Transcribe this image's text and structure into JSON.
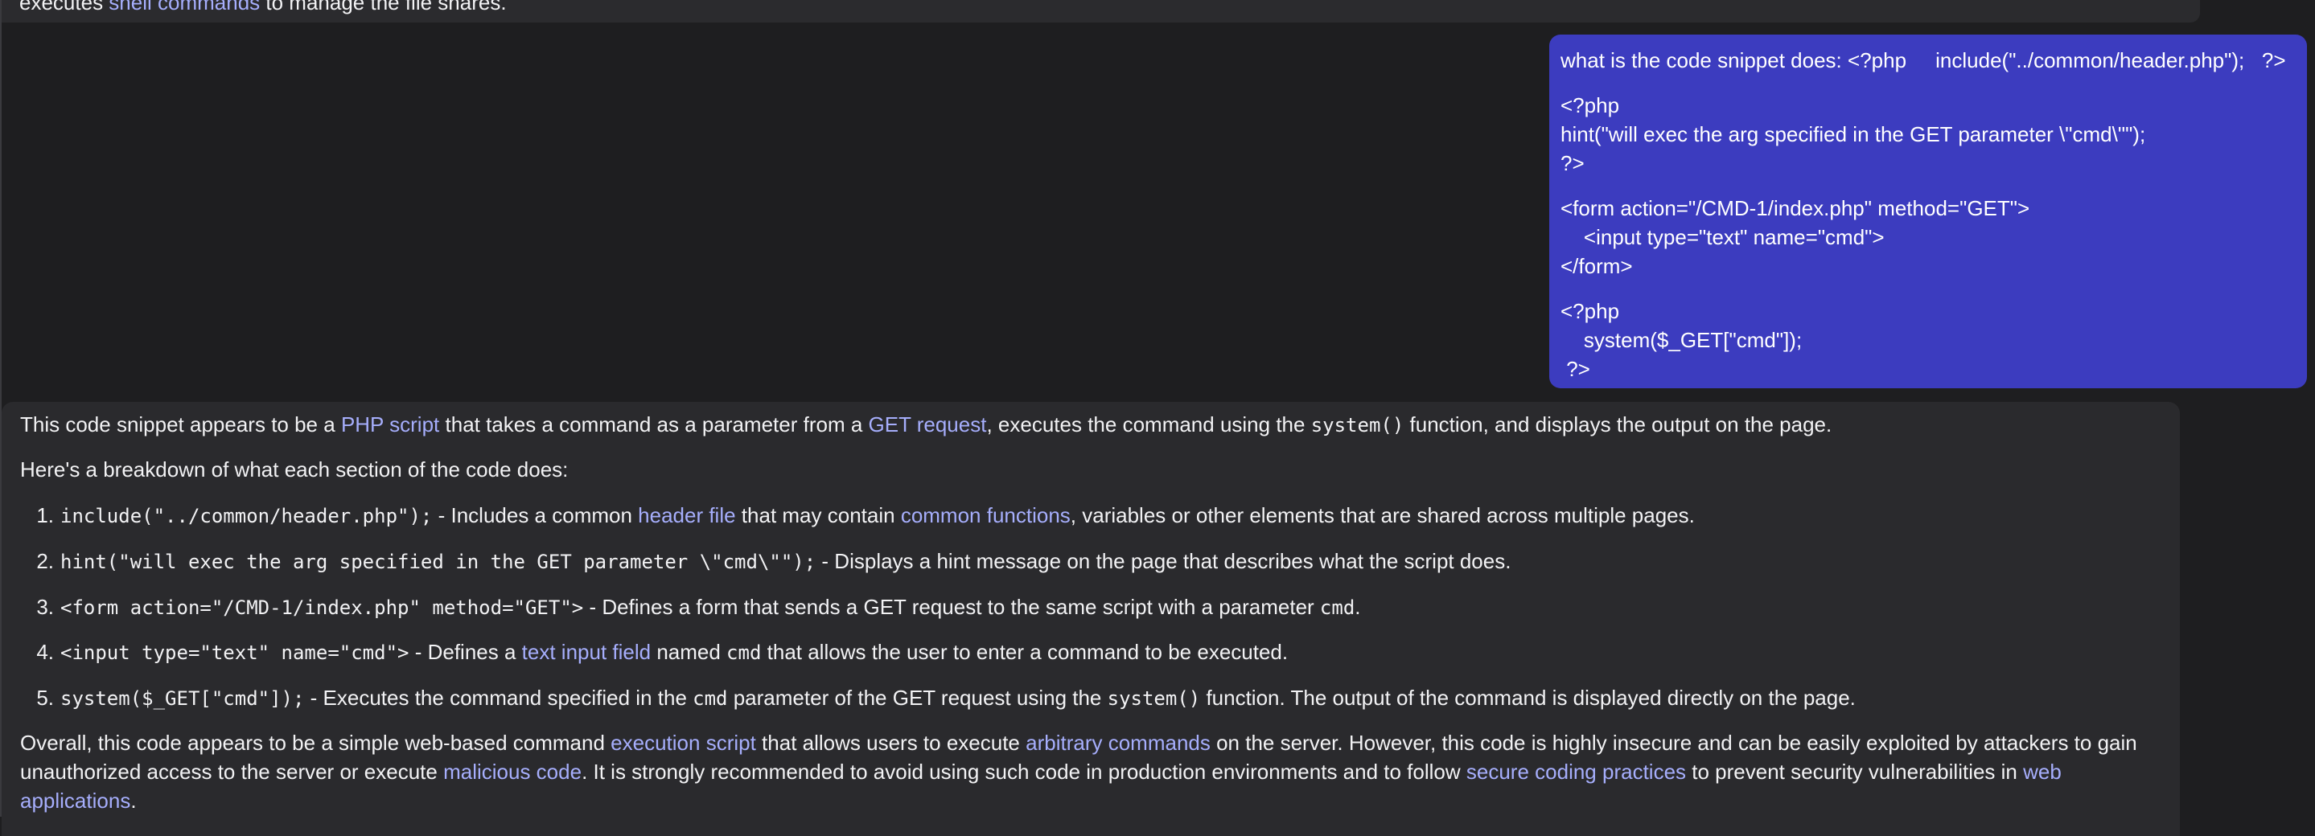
{
  "previous_message": {
    "pre": "executes ",
    "link": "shell commands",
    "post": " to manage the file shares."
  },
  "user_message": {
    "line1": "what is the code snippet does: <?php     include(\"../common/header.php\");   ?>",
    "block2": [
      "<?php",
      "hint(\"will exec the arg specified in the GET parameter \\\"cmd\\\"\");",
      "?>"
    ],
    "block3": [
      "<form action=\"/CMD-1/index.php\" method=\"GET\">",
      "    <input type=\"text\" name=\"cmd\">",
      "</form>"
    ],
    "block4": [
      "<?php",
      "    system($_GET[\"cmd\"]);",
      " ?>"
    ]
  },
  "assistant_message": {
    "intro": {
      "t1": "This code snippet appears to be a ",
      "l1": "PHP script",
      "t2": " that takes a command as a parameter from a ",
      "l2": "GET request",
      "t3": ", executes the command using the ",
      "c1": "system()",
      "t4": " function, and displays the output on the page."
    },
    "breakdown": "Here's a breakdown of what each section of the code does:",
    "items": [
      {
        "num": "1.",
        "code": "include(\"../common/header.php\");",
        "t1": " - Includes a common ",
        "l1": "header file",
        "t2": " that may contain ",
        "l2": "common functions",
        "t3": ", variables or other elements that are shared across multiple pages."
      },
      {
        "num": "2.",
        "code": "hint(\"will exec the arg specified in the GET parameter \\\"cmd\\\"\");",
        "t1": " - Displays a hint message on the page that describes what the script does."
      },
      {
        "num": "3.",
        "code": "<form action=\"/CMD-1/index.php\" method=\"GET\">",
        "t1": " - Defines a form that sends a GET request to the same script with a parameter ",
        "c2": "cmd",
        "t2": "."
      },
      {
        "num": "4.",
        "code": "<input type=\"text\" name=\"cmd\">",
        "t1": " - Defines a ",
        "l1": "text input field",
        "t2": " named ",
        "c2": "cmd",
        "t3": " that allows the user to enter a command to be executed."
      },
      {
        "num": "5.",
        "code": "system($_GET[\"cmd\"]);",
        "t1": " - Executes the command specified in the ",
        "c2": "cmd",
        "t2": " parameter of the GET request using the ",
        "c3": "system()",
        "t3": " function. The output of the command is displayed directly on the page."
      }
    ],
    "overall": {
      "t1": "Overall, this code appears to be a simple web-based command ",
      "l1": "execution script",
      "t2": " that allows users to execute ",
      "l2": "arbitrary commands",
      "t3": " on the server. However, this code is highly insecure and can be easily exploited by attackers to gain unauthorized access to the server or execute ",
      "l3": "malicious code",
      "t4": ". It is strongly recommended to avoid using such code in production environments and to follow ",
      "l4": "secure coding practices",
      "t5": " to prevent security vulnerabilities in ",
      "l5": "web applications",
      "t6": "."
    }
  },
  "colors": {
    "background": "#1e1e20",
    "assistant_bubble": "#2a2a2d",
    "user_bubble": "#3c3cbf",
    "link": "#a6aefc"
  }
}
